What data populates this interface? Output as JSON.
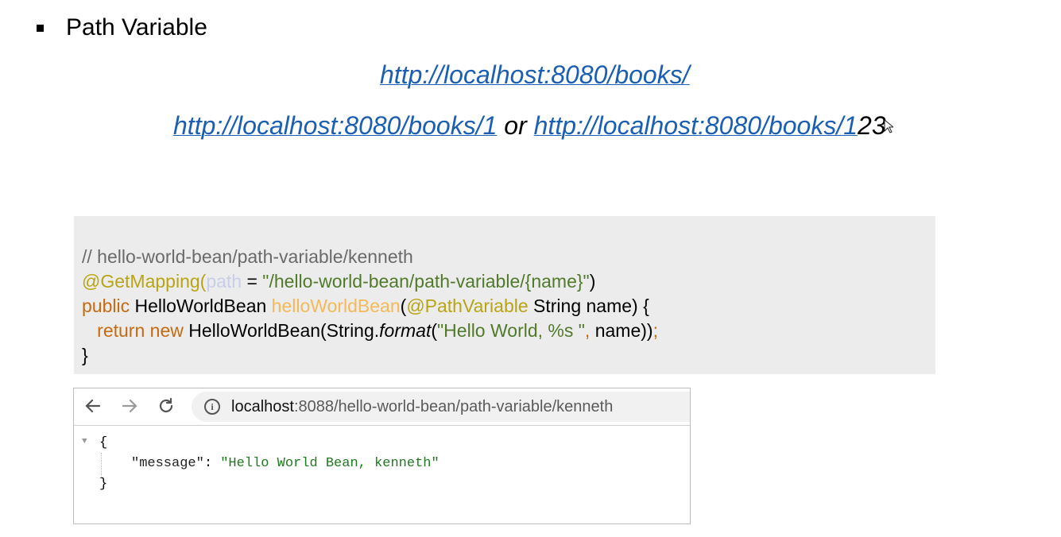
{
  "slide": {
    "bullet_title": "Path Variable",
    "link_books": "http://localhost:8080/books/",
    "link_book1": "http://localhost:8080/books/1",
    "or_word": "or",
    "link_book123_linked": "http://localhost:8080/books/1",
    "link_book123_tail": "23"
  },
  "code": {
    "comment": "// hello-world-bean/path-variable/kenneth",
    "annotation": "@GetMapping(",
    "path_param": "path",
    "path_eq": " = ",
    "path_value": "\"/hello-world-bean/path-variable/{name}\"",
    "annotation_close": ")",
    "public_kw": "public",
    "return_type": " HelloWorldBean ",
    "method_name": "helloWorldBean",
    "open_paren": "(",
    "path_variable_annot": "@PathVariable",
    "params": " String name) {",
    "indent": "   ",
    "return_kw": "return",
    "new_kw": " new",
    "ctor": " HelloWorldBean(String.",
    "format_call": "format",
    "format_open": "(",
    "format_str": "\"Hello World, %s \"",
    "comma": ",",
    "format_args": " name))",
    "semicolon": ";",
    "closing_brace": "}"
  },
  "browser": {
    "url_host": "localhost",
    "url_rest": ":8088/hello-world-bean/path-variable/kenneth",
    "json_open": "{",
    "json_key": "\"message\"",
    "json_colon": ": ",
    "json_value": "\"Hello World Bean, kenneth\"",
    "json_close": "}"
  },
  "colors": {
    "link": "#1a5fb4",
    "code_bg": "#ececec",
    "annotation": "#b8a415",
    "string": "#507a2a",
    "keyword": "#c56a10",
    "json_value": "#1f7a1f"
  },
  "icons": {
    "back": "arrow-left-icon",
    "forward": "arrow-right-icon",
    "reload": "reload-icon",
    "info": "info-icon",
    "collapse": "triangle-down-icon"
  }
}
